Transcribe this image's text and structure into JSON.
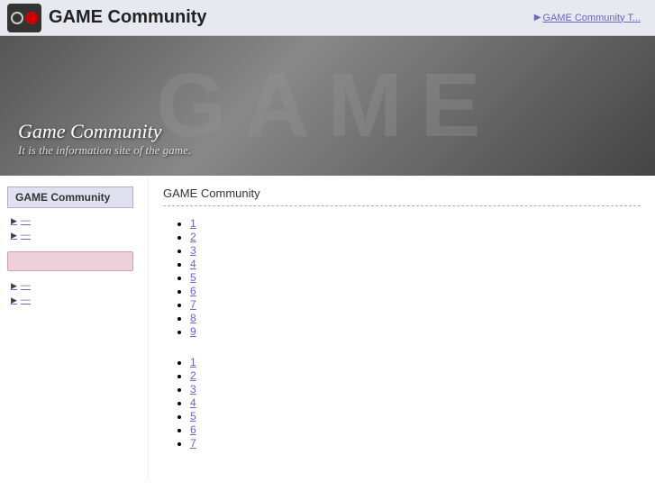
{
  "topbar": {
    "title": "GAME Community",
    "toplink": "GAME Community T...",
    "arrow": "▶"
  },
  "banner": {
    "game_text": "GAME",
    "title": "Game Community",
    "subtitle": "It is the information site of the game."
  },
  "sidebar": {
    "title": "GAME Community",
    "nav1": [
      {
        "label": "—"
      },
      {
        "label": "—"
      }
    ],
    "nav2": [
      {
        "label": "—"
      },
      {
        "label": "—"
      }
    ]
  },
  "content": {
    "heading": "GAME Community",
    "list1": [
      "1",
      "2",
      "3",
      "4",
      "5",
      "6",
      "7",
      "8",
      "9"
    ],
    "list2": [
      "1",
      "2",
      "3",
      "4",
      "5",
      "6",
      "7"
    ]
  }
}
